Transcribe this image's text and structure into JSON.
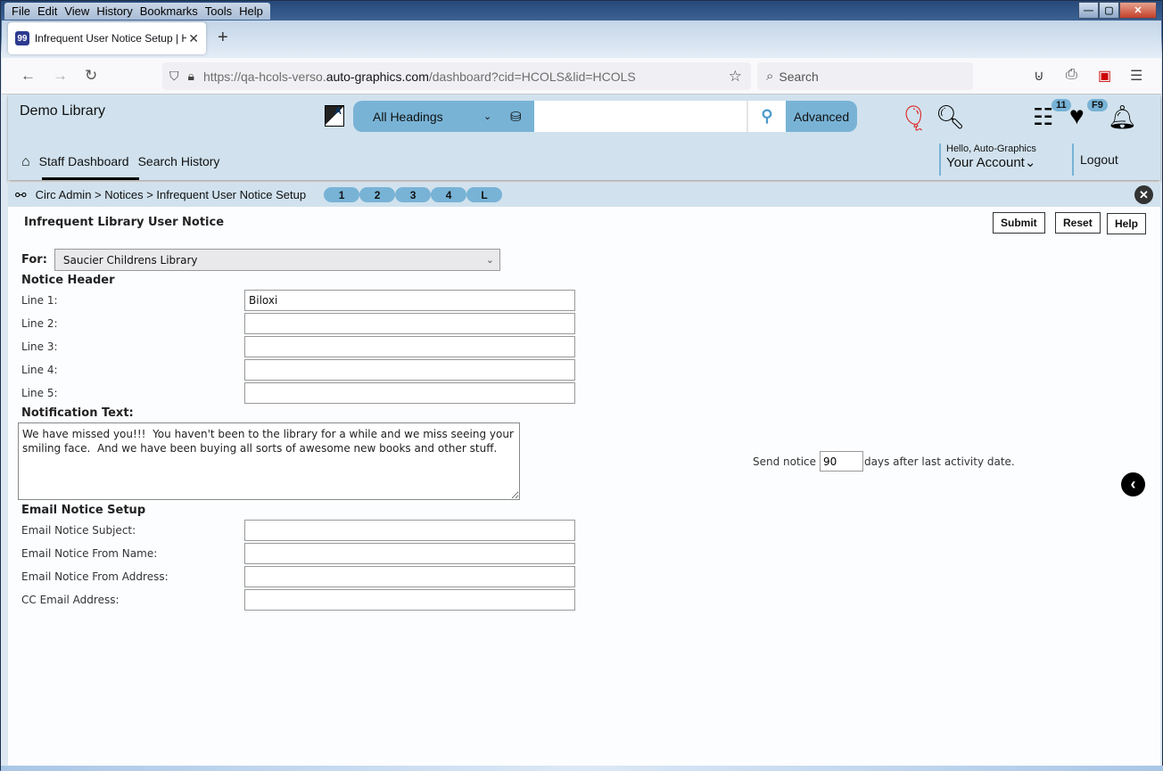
{
  "browser": {
    "menu": [
      "File",
      "Edit",
      "View",
      "History",
      "Bookmarks",
      "Tools",
      "Help"
    ],
    "tab_title": "Infrequent User Notice Setup | H",
    "url_prefix": "https://qa-hcols-verso.",
    "url_domain": "auto-graphics.com",
    "url_suffix": "/dashboard?cid=HCOLS&lid=HCOLS",
    "search_placeholder": "Search"
  },
  "header": {
    "library_name": "Demo Library",
    "search_scope": "All Headings",
    "search_value": "",
    "advanced_label": "Advanced",
    "list_badge": "11",
    "favorites_badge": "F9",
    "greeting": "Hello, Auto-Graphics",
    "account_label": "Your Account",
    "logout_label": "Logout",
    "nav": [
      "Staff Dashboard",
      "Search History"
    ]
  },
  "breadcrumb": {
    "path": "Circ Admin > Notices > Infrequent User Notice Setup",
    "pills": [
      "1",
      "2",
      "3",
      "4",
      "L"
    ]
  },
  "form": {
    "title": "Infrequent Library User Notice",
    "buttons": {
      "submit": "Submit",
      "reset": "Reset",
      "help": "Help"
    },
    "for_label": "For:",
    "for_value": "Saucier Childrens Library",
    "notice_header_title": "Notice Header",
    "header_lines": [
      {
        "label": "Line 1:",
        "value": "Biloxi"
      },
      {
        "label": "Line 2:",
        "value": ""
      },
      {
        "label": "Line 3:",
        "value": ""
      },
      {
        "label": "Line 4:",
        "value": ""
      },
      {
        "label": "Line 5:",
        "value": ""
      }
    ],
    "notification_title": "Notification Text:",
    "notification_text": "We have missed you!!!  You haven't been to the library for a while and we miss seeing your smiling face.  And we have been buying all sorts of awesome new books and other stuff.",
    "send_notice_label": "Send notice",
    "send_notice_days": "90",
    "send_notice_suffix": "days after last activity date.",
    "email_title": "Email Notice Setup",
    "email_fields": [
      {
        "label": "Email Notice Subject:",
        "value": ""
      },
      {
        "label": "Email Notice From Name:",
        "value": ""
      },
      {
        "label": "Email Notice From Address:",
        "value": ""
      },
      {
        "label": "CC Email Address:",
        "value": ""
      }
    ]
  }
}
